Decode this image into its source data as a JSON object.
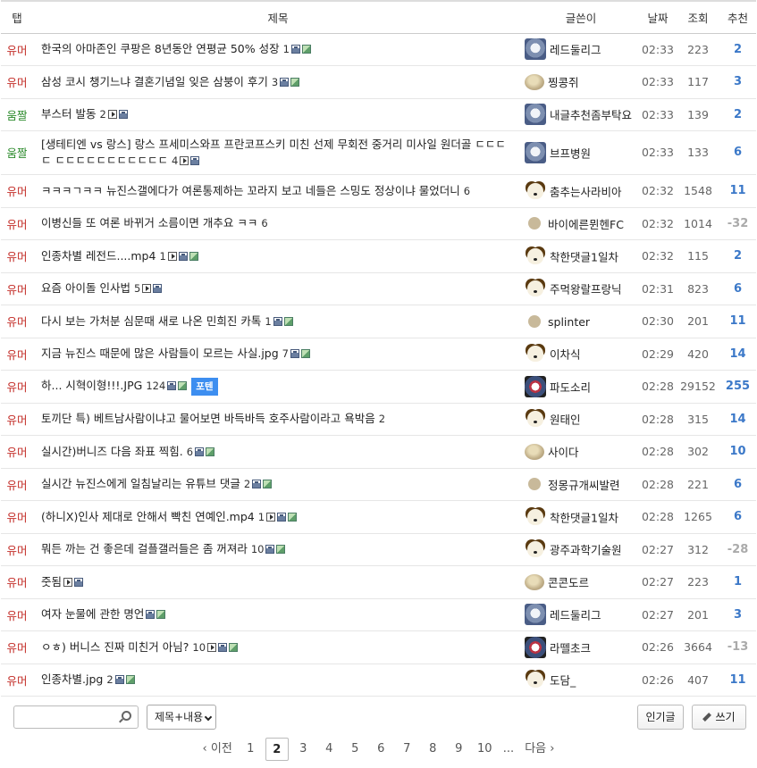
{
  "header": {
    "tab": "탭",
    "title": "제목",
    "writer": "글쓴이",
    "date": "날짜",
    "views": "조회",
    "rec": "추천"
  },
  "rows": [
    {
      "tab": "유머",
      "title": "한국의 아마존인 쿠팡은 8년동안 연평균 50% 성장",
      "comments": "1",
      "icons": [
        "file",
        "img"
      ],
      "writer": "레드둘리그",
      "avatar": "mech",
      "date": "02:33",
      "views": "223",
      "rec": "2"
    },
    {
      "tab": "유머",
      "title": "삼성 코시 챙기느냐 결혼기념일 잊은 삼붕이 후기",
      "comments": "3",
      "icons": [
        "file",
        "img"
      ],
      "writer": "찡콩쥐",
      "avatar": "potato",
      "date": "02:33",
      "views": "117",
      "rec": "3"
    },
    {
      "tab": "움짤",
      "title": "부스터 발동",
      "comments": "2",
      "icons": [
        "video",
        "file"
      ],
      "writer": "내글추천좀부탁요",
      "avatar": "mech",
      "date": "02:33",
      "views": "139",
      "rec": "2"
    },
    {
      "tab": "움짤",
      "title": "[생테티엔 vs 랑스] 랑스 프세미스와프 프란코프스키 미친 선제 무회전 중거리 미사일 원더골 ㄷㄷㄷㄷ ㄷㄷㄷㄷㄷㄷㄷㄷㄷㄷㄷ",
      "comments": "4",
      "icons": [
        "video",
        "file"
      ],
      "writer": "브프병원",
      "avatar": "mech",
      "date": "02:33",
      "views": "133",
      "rec": "6"
    },
    {
      "tab": "유머",
      "title": "ㅋㅋㅋㄱㅋㅋ 뉴진스갤에다가 여론통제하는 꼬라지 보고 네들은 스밍도 정상이냐 물었더니",
      "comments": "6",
      "icons": [],
      "writer": "춤추는사라비아",
      "avatar": "dog",
      "date": "02:32",
      "views": "1548",
      "rec": "11"
    },
    {
      "tab": "유머",
      "title": "이병신들 또 여론 바뀌거 소름이면 개추요 ㅋㅋ",
      "comments": "6",
      "icons": [],
      "writer": "바이에른뮌헨FC",
      "avatar": "dot",
      "date": "02:32",
      "views": "1014",
      "rec": "-32"
    },
    {
      "tab": "유머",
      "title": "인종차별 레전드....mp4",
      "comments": "1",
      "icons": [
        "video",
        "file",
        "img"
      ],
      "writer": "착한댓글1일차",
      "avatar": "dog",
      "date": "02:32",
      "views": "115",
      "rec": "2"
    },
    {
      "tab": "유머",
      "title": "요즘 아이돌 인사법",
      "comments": "5",
      "icons": [
        "video",
        "file"
      ],
      "writer": "주먹왕랄프랑닉",
      "avatar": "dog",
      "date": "02:31",
      "views": "823",
      "rec": "6"
    },
    {
      "tab": "유머",
      "title": "다시 보는 가처분 심문때 새로 나온 민희진 카톡",
      "comments": "1",
      "icons": [
        "file",
        "img"
      ],
      "writer": "splinter",
      "avatar": "dot",
      "date": "02:30",
      "views": "201",
      "rec": "11"
    },
    {
      "tab": "유머",
      "title": "지금 뉴진스 때문에 많은 사람들이 모르는 사실.jpg",
      "comments": "7",
      "icons": [
        "file",
        "img"
      ],
      "writer": "이차식",
      "avatar": "dog",
      "date": "02:29",
      "views": "420",
      "rec": "14"
    },
    {
      "tab": "유머",
      "title": "하... 시혁이형!!!.JPG",
      "comments": "124",
      "icons": [
        "file",
        "img"
      ],
      "badge": "포텐",
      "writer": "파도소리",
      "avatar": "mech2",
      "date": "02:28",
      "views": "29152",
      "rec": "255"
    },
    {
      "tab": "유머",
      "title": "토끼단 특) 베트남사람이냐고 물어보면 바득바득 호주사람이라고 욕박음",
      "comments": "2",
      "icons": [],
      "writer": "원태인",
      "avatar": "dog",
      "date": "02:28",
      "views": "315",
      "rec": "14"
    },
    {
      "tab": "유머",
      "title": "실시간)버니즈 다음 좌표 찍힘.",
      "comments": "6",
      "icons": [
        "file",
        "img"
      ],
      "writer": "사이다",
      "avatar": "potato",
      "date": "02:28",
      "views": "302",
      "rec": "10"
    },
    {
      "tab": "유머",
      "title": "실시간 뉴진스에게 일침날리는 유튜브 댓글",
      "comments": "2",
      "icons": [
        "file",
        "img"
      ],
      "writer": "정몽규개씨발련",
      "avatar": "dot",
      "date": "02:28",
      "views": "221",
      "rec": "6"
    },
    {
      "tab": "유머",
      "title": "(하니X)인사 제대로 안해서 빡친 연예인.mp4",
      "comments": "1",
      "icons": [
        "video",
        "file",
        "img"
      ],
      "writer": "착한댓글1일차",
      "avatar": "dog",
      "date": "02:28",
      "views": "1265",
      "rec": "6"
    },
    {
      "tab": "유머",
      "title": "뭐든 까는 건 좋은데 걸플갤러들은 좀 꺼져라",
      "comments": "10",
      "icons": [
        "file",
        "img"
      ],
      "writer": "광주과학기술원",
      "avatar": "dog",
      "date": "02:27",
      "views": "312",
      "rec": "-28"
    },
    {
      "tab": "유머",
      "title": "줏됨",
      "comments": "",
      "icons": [
        "video",
        "file"
      ],
      "writer": "콘콘도르",
      "avatar": "potato",
      "date": "02:27",
      "views": "223",
      "rec": "1"
    },
    {
      "tab": "유머",
      "title": "여자 눈물에 관한 명언",
      "comments": "",
      "icons": [
        "file",
        "img"
      ],
      "writer": "레드둘리그",
      "avatar": "mech",
      "date": "02:27",
      "views": "201",
      "rec": "3"
    },
    {
      "tab": "유머",
      "title": "ㅇㅎ) 버니스 진짜 미친거 아님?",
      "comments": "10",
      "icons": [
        "video",
        "file",
        "img"
      ],
      "writer": "라뗄초크",
      "avatar": "mech2",
      "date": "02:26",
      "views": "3664",
      "rec": "-13"
    },
    {
      "tab": "유머",
      "title": "인종차별.jpg",
      "comments": "2",
      "icons": [
        "file",
        "img"
      ],
      "writer": "도담_",
      "avatar": "dog",
      "date": "02:26",
      "views": "407",
      "rec": "11"
    }
  ],
  "search": {
    "value": "",
    "placeholder": ""
  },
  "search_type": "제목+내용",
  "buttons": {
    "best": "인기글",
    "write": "쓰기"
  },
  "pagination": {
    "prev": "‹ 이전",
    "pages": [
      "1",
      "2",
      "3",
      "4",
      "5",
      "6",
      "7",
      "8",
      "9",
      "10"
    ],
    "current": "2",
    "ellipsis": "...",
    "next": "다음 ›"
  },
  "colors": {
    "humor": "#c4302b",
    "gif": "#2b8a2b",
    "rec": "#3b78c8",
    "rec_neg": "#aaaaaa",
    "badge": "#3d8ef0"
  }
}
